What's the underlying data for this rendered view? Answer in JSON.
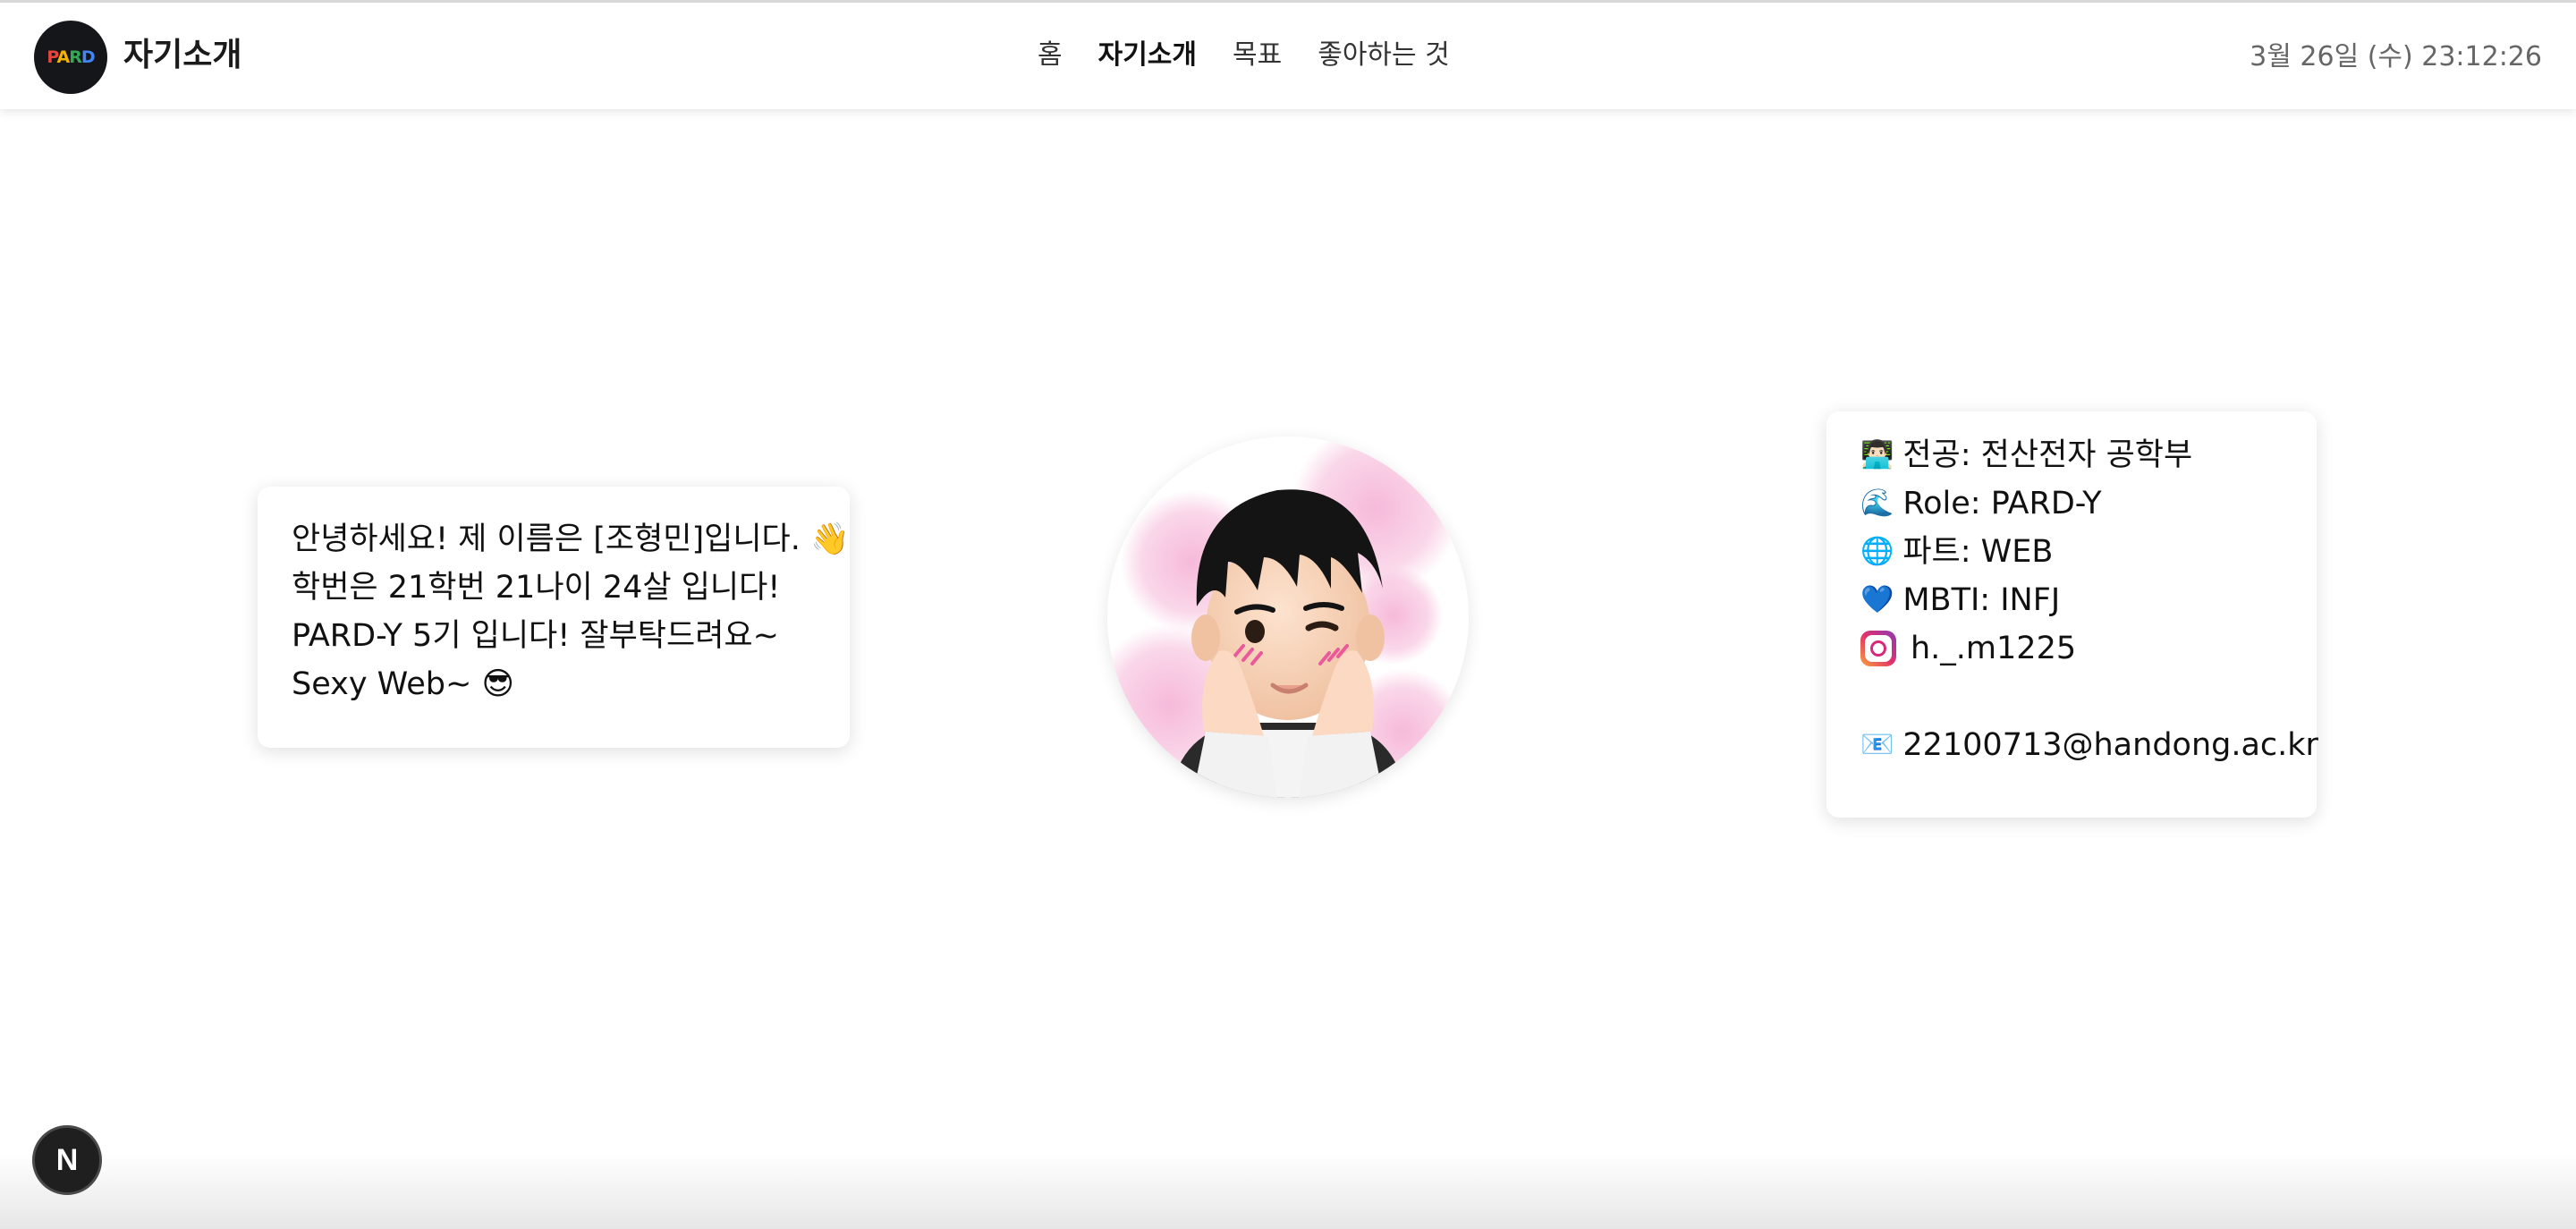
{
  "header": {
    "logo_text": "PARD",
    "title": "자기소개",
    "nav": [
      {
        "label": "홈",
        "active": false
      },
      {
        "label": "자기소개",
        "active": true
      },
      {
        "label": "목표",
        "active": false
      },
      {
        "label": "좋아하는 것",
        "active": false
      }
    ],
    "datetime": "3월 26일 (수) 23:12:26"
  },
  "intro": {
    "lines": [
      "안녕하세요! 제 이름은 [조형민]입니다. 👋",
      "학번은 21학번 21나이 24살 입니다!",
      "PARD-Y 5기 입니다! 잘부탁드려요~",
      "Sexy Web~ 😎"
    ]
  },
  "profile": {
    "major_icon": "👨🏻‍💻",
    "major": "전공: 전산전자 공학부",
    "role_icon": "🌊",
    "role": "Role: PARD-Y",
    "part_icon": "🌐",
    "part": "파트: WEB",
    "mbti_icon": "💙",
    "mbti": "MBTI: INFJ",
    "instagram_icon": "instagram-icon",
    "instagram": "h._.m1225",
    "email_icon": "📧",
    "email": "22100713@handong.ac.kr"
  },
  "avatar": {
    "icon": "memoji-avatar"
  },
  "badge": {
    "label": "N"
  },
  "colors": {
    "logo_bg": "#15161a",
    "logo_p": "#e8453c",
    "logo_a": "#f5b400",
    "logo_r": "#34a853",
    "logo_d": "#4285f4",
    "cheek_pink": "#f6b6d8",
    "badge_bg": "#1f1f1f"
  }
}
